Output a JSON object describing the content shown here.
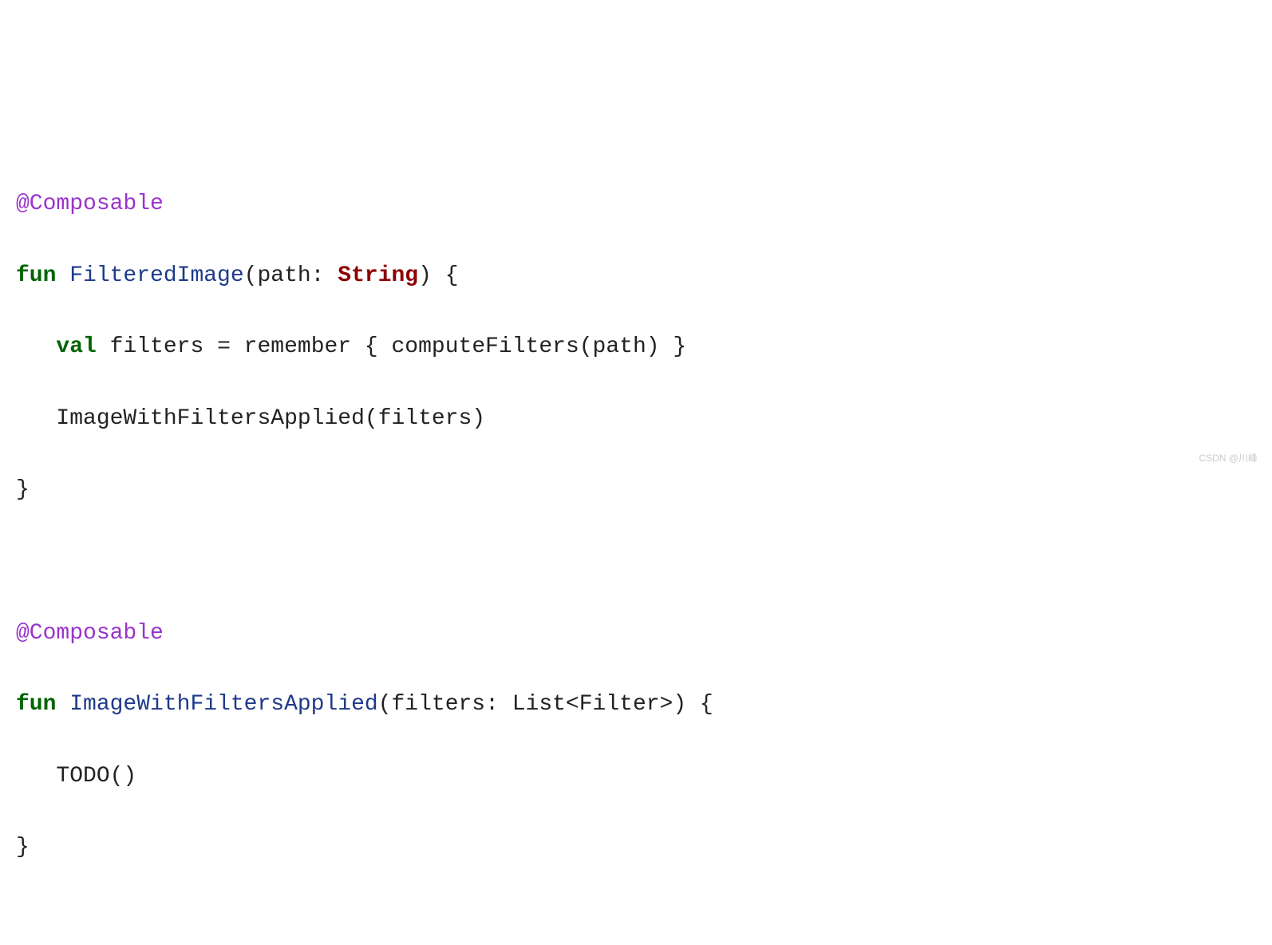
{
  "code": {
    "line1": {
      "annotation": "@Composable"
    },
    "line2": {
      "kw_fun": "fun",
      "func": " FilteredImage",
      "after_func": "(path: ",
      "type": "String",
      "close": ") {"
    },
    "line3": {
      "indent": "   ",
      "kw_val": "val",
      "rest": " filters = remember { computeFilters(path) }"
    },
    "line4": {
      "indent": "   ",
      "rest": "ImageWithFiltersApplied(filters)"
    },
    "line5": {
      "brace": "}"
    },
    "line6": {
      "blank": " "
    },
    "line7": {
      "annotation": "@Composable"
    },
    "line8": {
      "kw_fun": "fun",
      "func": " ImageWithFiltersApplied",
      "after_func": "(filters: List<Filter>) {"
    },
    "line9": {
      "indent": "   ",
      "rest": "TODO()"
    },
    "line10": {
      "brace": "}"
    }
  },
  "watermark": "CSDN @川峰"
}
